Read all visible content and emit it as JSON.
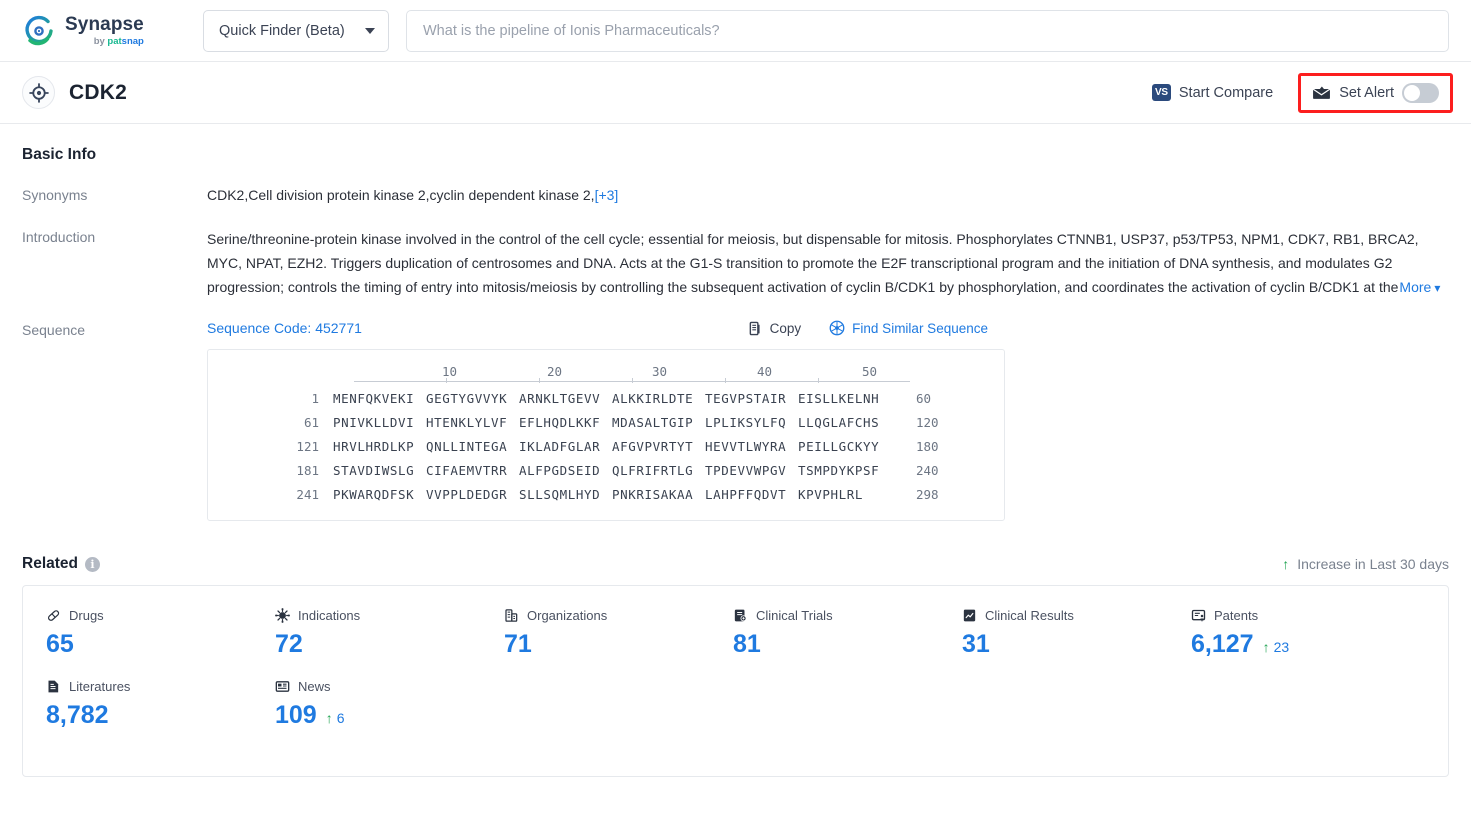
{
  "topbar": {
    "logo_word": "Synapse",
    "logo_sub_by": "by ",
    "logo_sub_pat": "pat",
    "logo_sub_snap": "snap",
    "finder_label": "Quick Finder (Beta)",
    "search_placeholder": "What is the pipeline of Ionis Pharmaceuticals?",
    "search_value": ""
  },
  "titlebar": {
    "title": "CDK2",
    "vs_label": "VS",
    "compare_label": "Start Compare",
    "alert_label": "Set Alert",
    "alert_toggle_state": "off",
    "highlight_color": "#fc1e1e"
  },
  "basic_info": {
    "heading": "Basic Info",
    "synonyms_label": "Synonyms",
    "synonyms_value": "CDK2,Cell division protein kinase 2,cyclin dependent kinase 2,",
    "synonyms_more": "[+3]",
    "introduction_label": "Introduction",
    "introduction_text": "Serine/threonine-protein kinase involved in the control of the cell cycle; essential for meiosis, but dispensable for mitosis. Phosphorylates CTNNB1, USP37, p53/TP53, NPM1, CDK7, RB1, BRCA2, MYC, NPAT, EZH2. Triggers duplication of centrosomes and DNA. Acts at the G1-S transition to promote the E2F transcriptional program and the initiation of DNA synthesis, and modulates G2 progression; controls the timing of entry into mitosis/meiosis by controlling the subsequent activation of cyclin B/CDK1 by phosphorylation, and coordinates the activation of cyclin B/CDK1 at ",
    "introduction_fade_tail": "the",
    "more_label": "More"
  },
  "sequence": {
    "label": "Sequence",
    "code_label": "Sequence Code: 452771",
    "copy_label": "Copy",
    "find_similar_label": "Find Similar Sequence",
    "ruler_ticks": [
      "10",
      "20",
      "30",
      "40",
      "50"
    ],
    "lines": [
      {
        "start": "1",
        "chunks": [
          "MENFQKVEKI",
          "GEGTYGVVYK",
          "ARNKLTGEVV",
          "ALKKIRLDTE",
          "TEGVPSTAIR",
          "EISLLKELNH"
        ],
        "end": "60"
      },
      {
        "start": "61",
        "chunks": [
          "PNIVKLLDVI",
          "HTENKLYLVF",
          "EFLHQDLKKF",
          "MDASALTGIP",
          "LPLIKSYLFQ",
          "LLQGLAFCHS"
        ],
        "end": "120"
      },
      {
        "start": "121",
        "chunks": [
          "HRVLHRDLKP",
          "QNLLINTEGA",
          "IKLADFGLAR",
          "AFGVPVRTYT",
          "HEVVTLWYRA",
          "PEILLGCKYY"
        ],
        "end": "180"
      },
      {
        "start": "181",
        "chunks": [
          "STAVDIWSLG",
          "CIFAEMVTRR",
          "ALFPGDSEID",
          "QLFRIFRTLG",
          "TPDEVVWPGV",
          "TSMPDYKPSF"
        ],
        "end": "240"
      },
      {
        "start": "241",
        "chunks": [
          "PKWARQDFSK",
          "VVPPLDEDGR",
          "SLLSQMLHYD",
          "PNKRISAKAA",
          "LAHPFFQDVT",
          "KPVPHLRL"
        ],
        "end": "298"
      }
    ]
  },
  "related": {
    "heading": "Related",
    "info_char": "i",
    "increase_note": "Increase in Last 30 days",
    "arrow_glyph": "↑",
    "metrics": [
      {
        "name": "Drugs",
        "icon": "pill-icon",
        "value": "65",
        "delta": ""
      },
      {
        "name": "Indications",
        "icon": "virus-icon",
        "value": "72",
        "delta": ""
      },
      {
        "name": "Organizations",
        "icon": "building-icon",
        "value": "71",
        "delta": ""
      },
      {
        "name": "Clinical Trials",
        "icon": "clinical-trial-icon",
        "value": "81",
        "delta": ""
      },
      {
        "name": "Clinical Results",
        "icon": "clinical-result-icon",
        "value": "31",
        "delta": ""
      },
      {
        "name": "Patents",
        "icon": "patent-icon",
        "value": "6,127",
        "delta": "23"
      },
      {
        "name": "Literatures",
        "icon": "literature-icon",
        "value": "8,782",
        "delta": ""
      },
      {
        "name": "News",
        "icon": "news-icon",
        "value": "109",
        "delta": "6"
      }
    ]
  },
  "colors": {
    "accent_blue": "#1f7ae0",
    "increase_green": "#21a453",
    "alert_red": "#fc1e1e"
  }
}
